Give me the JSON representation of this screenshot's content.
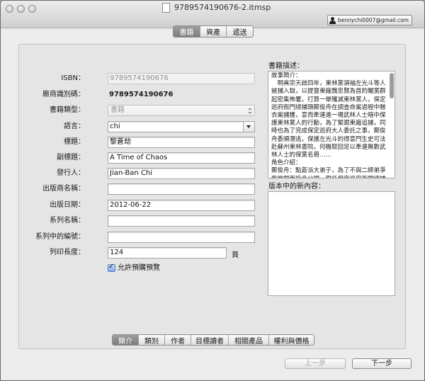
{
  "window": {
    "title": "9789574190676-2.itmsp",
    "user": "bennychi0007@gmail.com"
  },
  "top_tabs": [
    {
      "label": "書籍",
      "selected": true
    },
    {
      "label": "資產",
      "selected": false
    },
    {
      "label": "遞送",
      "selected": false
    }
  ],
  "form": {
    "isbn": {
      "label": "ISBN：",
      "value": "9789574190676"
    },
    "vendor_id": {
      "label": "廠商識別碼：",
      "value": "9789574190676"
    },
    "book_type": {
      "label": "書籍類型：",
      "value": "書籍"
    },
    "language": {
      "label": "語言：",
      "value": "chi"
    },
    "title": {
      "label": "標題：",
      "value": "黎蒼劫"
    },
    "subtitle": {
      "label": "副標題：",
      "value": "A Time of Chaos"
    },
    "publisher": {
      "label": "發行人：",
      "value": "Jian-Ban Chi"
    },
    "imprint": {
      "label": "出版商名稱：",
      "value": ""
    },
    "pub_date": {
      "label": "出版日期：",
      "value": "2012-06-22"
    },
    "series_name": {
      "label": "系列名稱：",
      "value": ""
    },
    "series_number": {
      "label": "系列中的編號：",
      "value": ""
    },
    "print_length": {
      "label": "列印長度：",
      "value": "124",
      "unit": "頁"
    },
    "preorder": {
      "label": "允許預購預覽",
      "checked": true
    }
  },
  "description": {
    "label": "書籍描述：",
    "text": "故事簡介：\n　明熹宗天啟四年，東林黨領袖左光斗等人被捕入獄，以提督東廠魏忠賢為首的閹黨群起密集佈署，打算一舉殲滅東林黨人，保定巡府衙門總捕頭鄭俊舟在調查命案過程中贈衣案捕獲，意而牽連進一場武林人士暗中保護東林黨人的行動，為了緊跟東廠追捕，同時也為了完成保定巡府大人委託之事，鄭俊舟委順潛逃，保護左光斗的得意門生史可法赴蘇州東林書院，何機取回足以牽連無數武林人士的保黨名冊……\n角色介紹：\n鄭俊舟：點蒼派大弟子，為了不與二師弟爭奪掌門而投身公門，現任保定巡府衙門總捕頭，他在調查一件尋常命案時捲入東廠的陰謀，一夜之間成為東廠鷹犬追殺的要犯……"
  },
  "new_content": {
    "label": "版本中的新內容：",
    "text": ""
  },
  "bottom_tabs": [
    {
      "label": "簡介",
      "selected": true
    },
    {
      "label": "類別",
      "selected": false
    },
    {
      "label": "作者",
      "selected": false
    },
    {
      "label": "目標讀者",
      "selected": false
    },
    {
      "label": "相關產品",
      "selected": false
    },
    {
      "label": "權利與價格",
      "selected": false
    }
  ],
  "buttons": {
    "prev": "上一步",
    "next": "下一步"
  },
  "colors": {
    "selected_tab": "#8a8a8a",
    "window_bg": "#ececec",
    "panel_bg": "#e5e5e5"
  }
}
